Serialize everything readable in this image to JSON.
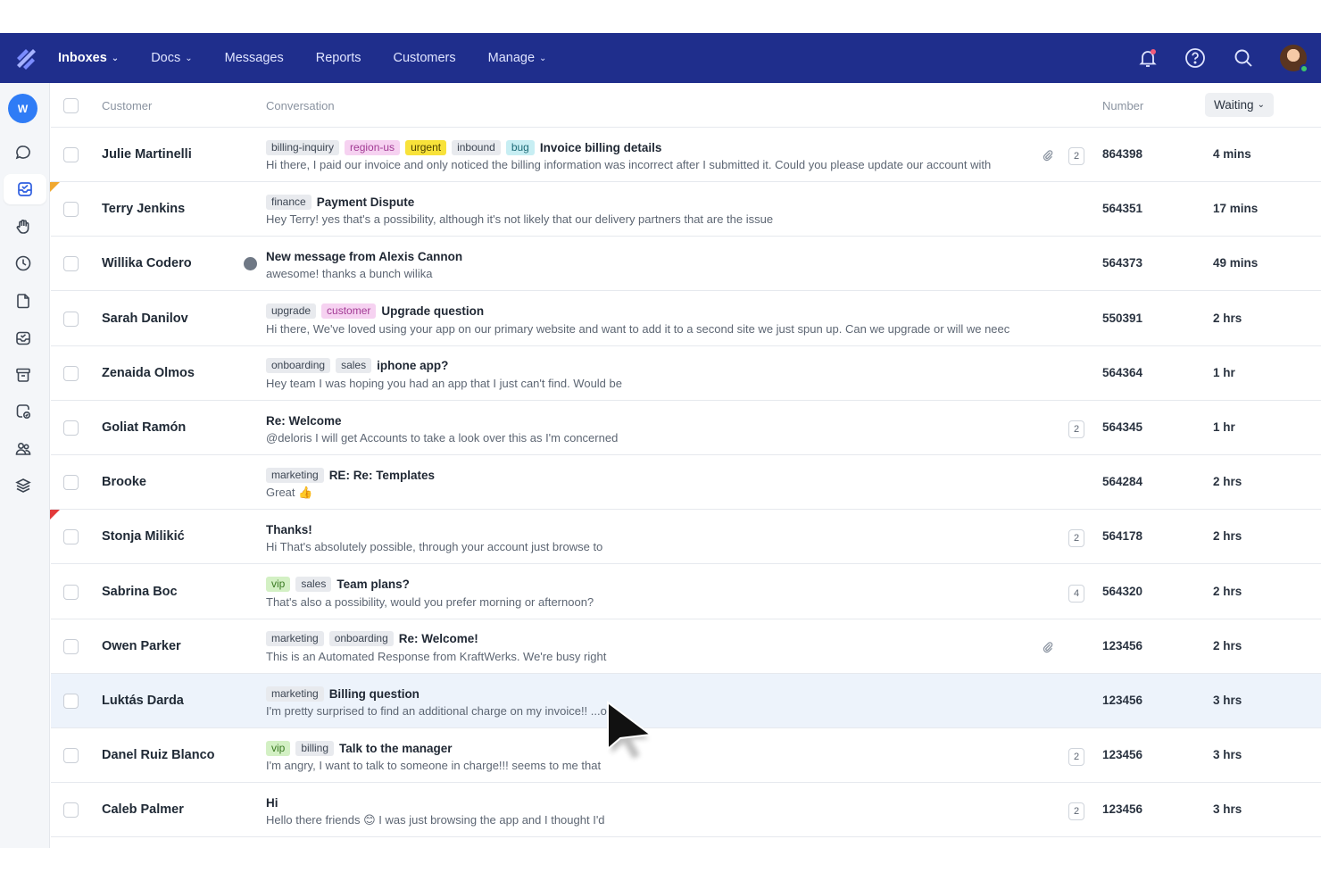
{
  "nav": {
    "items": [
      {
        "label": "Inboxes",
        "dropdown": true
      },
      {
        "label": "Docs",
        "dropdown": true
      },
      {
        "label": "Messages",
        "dropdown": false
      },
      {
        "label": "Reports",
        "dropdown": false
      },
      {
        "label": "Customers",
        "dropdown": false
      },
      {
        "label": "Manage",
        "dropdown": true
      }
    ],
    "icons": [
      "bell-icon",
      "help-icon",
      "search-icon",
      "avatar"
    ],
    "bar_color": "#1f2e8c"
  },
  "sidebar": {
    "workspace_initial": "W",
    "icons": [
      "chat-icon",
      "inbox-icon",
      "hand-icon",
      "clock-icon",
      "document-icon",
      "inbox-check-icon",
      "archive-icon",
      "shield-icon",
      "people-icon",
      "layers-icon"
    ]
  },
  "table": {
    "headers": {
      "customer": "Customer",
      "conversation": "Conversation",
      "number": "Number",
      "waiting": "Waiting"
    },
    "rows": [
      {
        "customer": "Julie Martinelli",
        "tags": [
          {
            "label": "billing-inquiry",
            "color": "gray"
          },
          {
            "label": "region-us",
            "color": "pink"
          },
          {
            "label": "urgent",
            "color": "yellow"
          },
          {
            "label": "inbound",
            "color": "gray"
          },
          {
            "label": "bug",
            "color": "cyan"
          }
        ],
        "subject": "Invoice billing details",
        "preview": "Hi there, I paid our invoice and only noticed the billing information was  incorrect after I submitted it. Could you please update our account with",
        "attachment": true,
        "count": "2",
        "number": "864398",
        "waiting": "4 mins"
      },
      {
        "customer": "Terry Jenkins",
        "tags": [
          {
            "label": "finance",
            "color": "gray"
          }
        ],
        "subject": "Payment Dispute",
        "preview": "Hey Terry! yes that's a possibility, although it's not likely that our delivery partners that are the issue",
        "number": "564351",
        "waiting": "17 mins",
        "flag": "orange"
      },
      {
        "customer": "Willika Codero",
        "tags": [],
        "subject": "New message from Alexis Cannon",
        "preview": "awesome! thanks a bunch wilika",
        "number": "564373",
        "waiting": "49 mins",
        "messenger": true
      },
      {
        "customer": "Sarah Danilov",
        "tags": [
          {
            "label": "upgrade",
            "color": "gray"
          },
          {
            "label": "customer",
            "color": "pink"
          }
        ],
        "subject": "Upgrade question",
        "preview": "Hi there, We've loved using your app on our primary website and want to add it to a second site we just spun up. Can we upgrade or will we neec",
        "number": "550391",
        "waiting": "2 hrs"
      },
      {
        "customer": "Zenaida Olmos",
        "tags": [
          {
            "label": "onboarding",
            "color": "gray"
          },
          {
            "label": "sales",
            "color": "gray"
          }
        ],
        "subject": "iphone app?",
        "preview": "Hey team I was hoping you had an app that I just can't find. Would be",
        "number": "564364",
        "waiting": "1 hr"
      },
      {
        "customer": "Goliat Ramón",
        "tags": [],
        "subject": "Re: Welcome",
        "preview": "@deloris I will get Accounts to take a look over this as I'm concerned",
        "count": "2",
        "number": "564345",
        "waiting": "1 hr"
      },
      {
        "customer": "Brooke",
        "tags": [
          {
            "label": "marketing",
            "color": "gray"
          }
        ],
        "subject": "RE: Re: Templates",
        "preview": "Great 👍",
        "number": "564284",
        "waiting": "2 hrs"
      },
      {
        "customer": "Stonja Milikić",
        "tags": [],
        "subject": "Thanks!",
        "preview": "Hi That's absolutely possible, through your account just browse to",
        "count": "2",
        "number": "564178",
        "waiting": "2 hrs",
        "flag": "red"
      },
      {
        "customer": "Sabrina Boc",
        "tags": [
          {
            "label": "vip",
            "color": "green"
          },
          {
            "label": "sales",
            "color": "gray"
          }
        ],
        "subject": "Team plans?",
        "preview": "That's also a possibility, would you prefer morning or afternoon?",
        "count": "4",
        "number": "564320",
        "waiting": "2 hrs"
      },
      {
        "customer": "Owen Parker",
        "tags": [
          {
            "label": "marketing",
            "color": "gray"
          },
          {
            "label": "onboarding",
            "color": "gray"
          }
        ],
        "subject": "Re: Welcome!",
        "preview": "This is an Automated Response from KraftWerks. We're busy right",
        "attachment": true,
        "number": "123456",
        "waiting": "2 hrs"
      },
      {
        "customer": "Luktás Darda",
        "tags": [
          {
            "label": "marketing",
            "color": "gray"
          }
        ],
        "subject": "Billing question",
        "preview": "I'm pretty surprised to find an additional charge on my invoice!! ...on",
        "number": "123456",
        "waiting": "3 hrs",
        "highlighted": true
      },
      {
        "customer": "Danel Ruiz Blanco",
        "tags": [
          {
            "label": "vip",
            "color": "green"
          },
          {
            "label": "billing",
            "color": "gray"
          }
        ],
        "subject": "Talk to the manager",
        "preview": "I'm angry, I want to talk to someone in charge!!! seems to me that",
        "count": "2",
        "number": "123456",
        "waiting": "3 hrs"
      },
      {
        "customer": "Caleb Palmer",
        "tags": [],
        "subject": "Hi",
        "preview": "Hello there friends 😊 I was just browsing the app and I thought I'd",
        "count": "2",
        "number": "123456",
        "waiting": "3 hrs"
      }
    ]
  }
}
